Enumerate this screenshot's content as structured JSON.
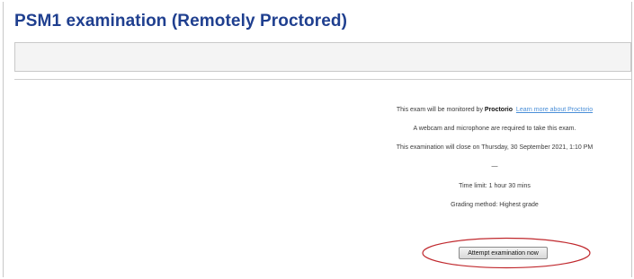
{
  "page": {
    "title": "PSM1 examination (Remotely Proctored)"
  },
  "info": {
    "monitor_prefix": "This exam will be monitored by ",
    "monitor_name": "Proctorio",
    "learn_more_link": "Learn more about Proctorio",
    "requirements": "A webcam and microphone are required to take this exam.",
    "close_date": "This examination will close on Thursday, 30 September 2021, 1:10 PM",
    "separator": "—",
    "time_limit": "Time limit: 1 hour 30 mins",
    "grading_method": "Grading method: Highest grade"
  },
  "actions": {
    "attempt_button_label": "Attempt examination now"
  },
  "colors": {
    "title": "#1f3f8f",
    "link": "#4a8fd8",
    "highlight_ellipse": "#c0282d"
  }
}
